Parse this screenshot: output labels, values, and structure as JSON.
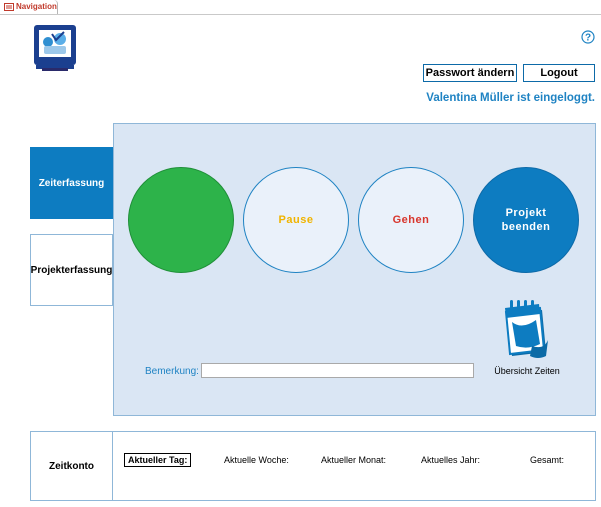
{
  "tab": {
    "label": "Navigation"
  },
  "header": {
    "password_button": "Passwort ändern",
    "logout_button": "Logout",
    "logged_in_text": "Valentina Müller ist eingeloggt."
  },
  "nav": {
    "items": [
      {
        "label": "Zeiterfassung",
        "active": true
      },
      {
        "label": "Projekterfassung",
        "active": false
      }
    ]
  },
  "actions": {
    "kommen": "",
    "pause": "Pause",
    "gehen": "Gehen",
    "projekt_beenden_line1": "Projekt",
    "projekt_beenden_line2": "beenden"
  },
  "remark": {
    "label": "Bemerkung:",
    "value": ""
  },
  "overview": {
    "label": "Übersicht Zeiten"
  },
  "zeitkonto": {
    "title": "Zeitkonto",
    "tag": "Aktueller Tag:",
    "woche": "Aktuelle Woche:",
    "monat": "Aktueller Monat:",
    "jahr": "Aktuelles Jahr:",
    "gesamt": "Gesamt:"
  },
  "colors": {
    "accent": "#0d7cc1",
    "panel_bg": "#dae6f4",
    "start_green": "#2db34a",
    "pause_yellow": "#f0b400",
    "gehen_red": "#d8352c"
  },
  "icons": [
    "form-icon",
    "logo-icon",
    "help-icon",
    "calendar-icon"
  ]
}
